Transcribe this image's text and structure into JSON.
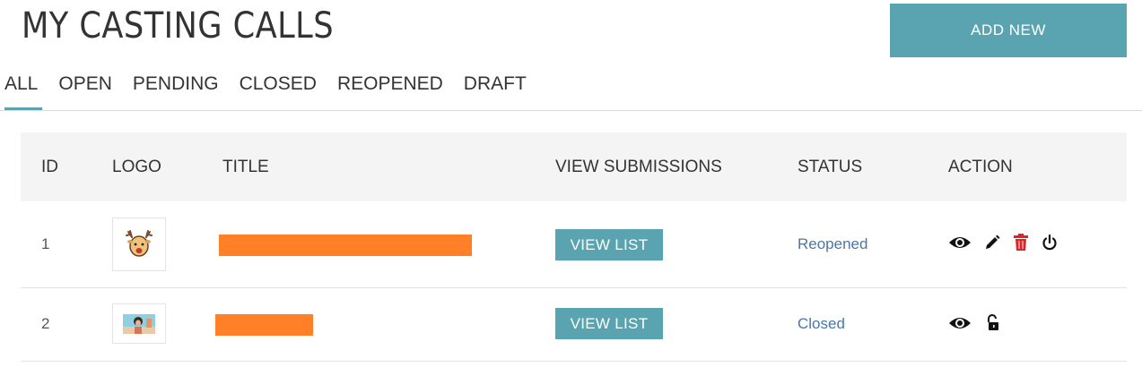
{
  "header": {
    "title": "MY CASTING CALLS",
    "add_button": "ADD NEW"
  },
  "tabs": [
    {
      "label": "ALL",
      "active": true
    },
    {
      "label": "OPEN"
    },
    {
      "label": "PENDING"
    },
    {
      "label": "CLOSED"
    },
    {
      "label": "REOPENED"
    },
    {
      "label": "DRAFT"
    }
  ],
  "table": {
    "columns": [
      "ID",
      "LOGO",
      "TITLE",
      "VIEW SUBMISSIONS",
      "STATUS",
      "ACTION"
    ],
    "rows": [
      {
        "id": "1",
        "logo_icon": "reindeer-logo-icon",
        "title": "",
        "view_label": "VIEW LIST",
        "status": "Reopened",
        "actions": [
          "eye-icon",
          "pencil-icon",
          "trash-icon",
          "power-icon"
        ]
      },
      {
        "id": "2",
        "logo_icon": "photo-thumbnail-icon",
        "title": "",
        "view_label": "VIEW LIST",
        "status": "Closed",
        "actions": [
          "eye-icon",
          "unlock-icon"
        ]
      }
    ]
  },
  "colors": {
    "accent": "#5aa4b1",
    "redacted": "#ff8026",
    "status_link": "#4a77a8",
    "delete": "#e02424"
  }
}
